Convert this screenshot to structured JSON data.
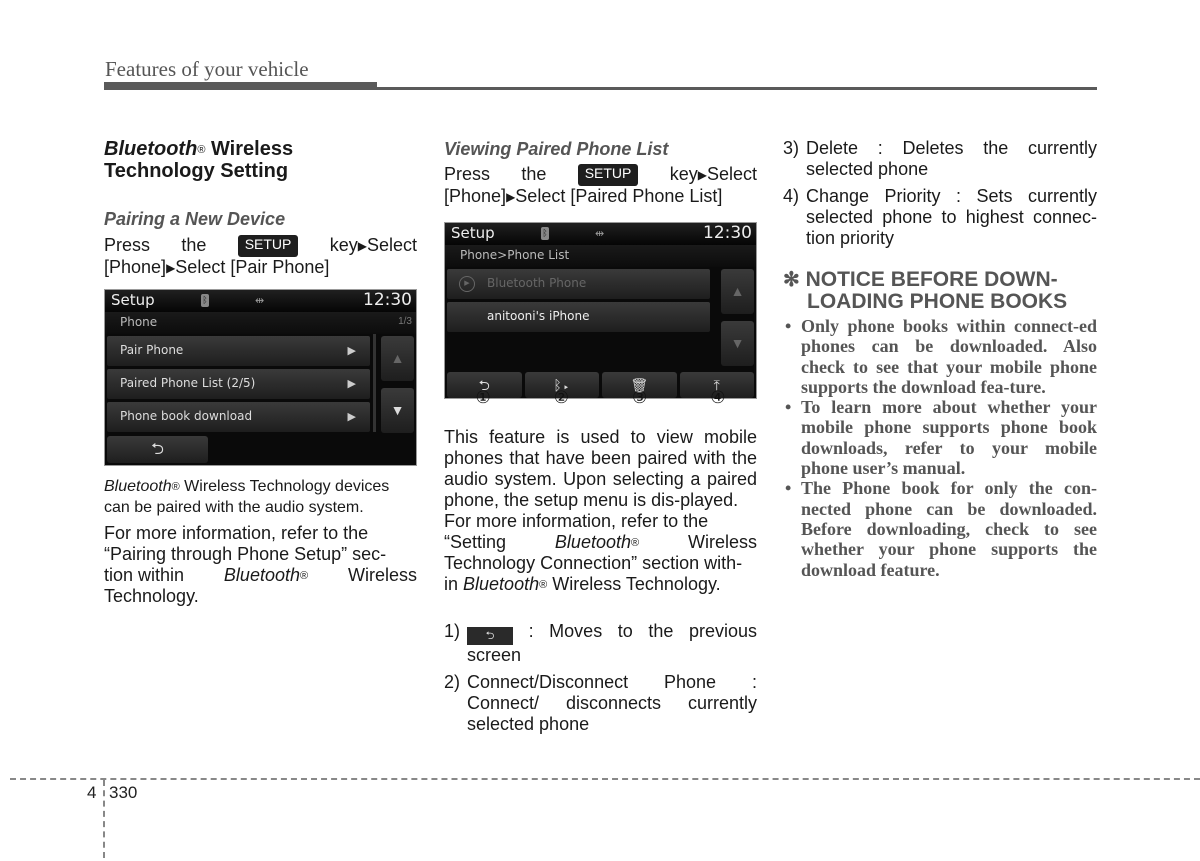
{
  "header": {
    "title": "Features of your vehicle"
  },
  "col1": {
    "title_italic": "Bluetooth",
    "title_reg": "®",
    "title_rest": "Wireless",
    "title_line2": "Technology Setting",
    "subtitle": "Pairing a New Device",
    "instr_press": "Press",
    "instr_the": "the",
    "setup_key": "SETUP",
    "instr_key_select": "key",
    "instr_select": "Select",
    "instr_line2_a": "[Phone]",
    "instr_line2_b": "Select [Pair Phone]",
    "screen": {
      "title": "Setup",
      "time": "12:30",
      "breadcrumb": "Phone",
      "page_indicator": "1/3",
      "items": [
        {
          "label": "Pair Phone"
        },
        {
          "label": "Paired Phone List  (2/5)"
        },
        {
          "label": "Phone book download"
        }
      ]
    },
    "caption_italic": "Bluetooth",
    "caption_rest": "Wireless Technology devices can be paired with the audio system.",
    "para_line1": "For more information, refer to the",
    "para_line2": "“Pairing through Phone Setup” sec-",
    "para_line3_a": "tion within",
    "para_line3_b": "Bluetooth",
    "para_line3_c": "Wireless",
    "para_line4": "Technology."
  },
  "col2": {
    "subtitle": "Viewing Paired Phone List",
    "instr_press": "Press",
    "instr_the": "the",
    "setup_key": "SETUP",
    "instr_key": "key",
    "instr_select": "Select",
    "instr_line2_a": "[Phone]",
    "instr_line2_b": "Select [Paired Phone List]",
    "screen": {
      "title": "Setup",
      "time": "12:30",
      "breadcrumb": "Phone>Phone List",
      "items": [
        {
          "label": "Bluetooth Phone",
          "state": "dimmed"
        },
        {
          "label": "anitooni's iPhone",
          "state": "normal"
        }
      ],
      "callouts": [
        "①",
        "②",
        "③",
        "④"
      ]
    },
    "para1": "This feature is used to view mobile phones that have been paired with the audio system. Upon selecting a paired phone, the setup menu is dis-played.",
    "para2_line1": "For more information, refer to the",
    "para2_line2_a": "“Setting",
    "para2_line2_b": "Bluetooth",
    "para2_line2_c": "Wireless",
    "para2_line3": "Technology Connection” section with-",
    "para2_line4_a": "in",
    "para2_line4_b": "Bluetooth",
    "para2_line4_c": "Wireless Technology.",
    "items": [
      {
        "num": "1)",
        "text_after_icon": ": Moves to the previous screen"
      },
      {
        "num": "2)",
        "text": "Connect/Disconnect Phone : Connect/ disconnects currently selected phone"
      }
    ]
  },
  "col3": {
    "items": [
      {
        "num": "3)",
        "text": "Delete : Deletes the currently selected phone"
      },
      {
        "num": "4)",
        "text": "Change Priority : Sets currently selected phone to highest connec-tion priority"
      }
    ],
    "notice_star": "✻",
    "notice_line1": "NOTICE BEFORE DOWN-",
    "notice_line2": "LOADING PHONE BOOKS",
    "bullets": [
      "Only phone books within connect-ed phones can be downloaded. Also check to see that your mobile phone supports the download fea-ture.",
      "To learn more about whether your mobile phone supports phone book downloads, refer to your mobile phone user’s manual.",
      "The Phone book for only the con-nected phone can be downloaded. Before downloading, check to see whether your phone supports the download feature."
    ]
  },
  "footer": {
    "chapter": "4",
    "page": "330"
  }
}
